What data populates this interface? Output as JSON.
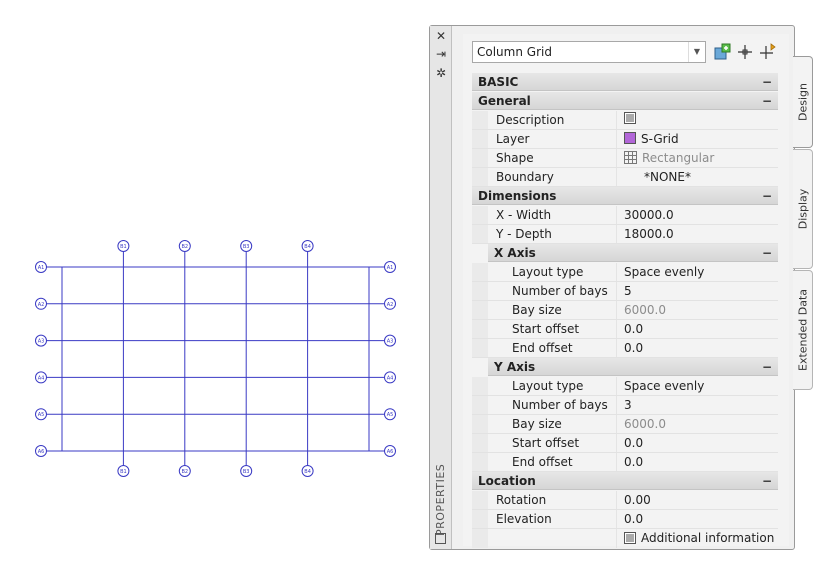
{
  "drawing": {
    "row_labels": [
      "A1",
      "A2",
      "A3",
      "A4",
      "A5",
      "A6"
    ],
    "col_labels": [
      "B1",
      "B2",
      "B3",
      "B4"
    ],
    "line_color": "#3a3ac4"
  },
  "palette": {
    "title": "PROPERTIES",
    "style_value": "Column Grid",
    "tabs": [
      "Design",
      "Display",
      "Extended Data"
    ],
    "sections": {
      "basic": "BASIC",
      "general": "General",
      "dimensions": "Dimensions",
      "x_axis": "X Axis",
      "y_axis": "Y Axis",
      "location": "Location"
    },
    "general": [
      {
        "label": "Description",
        "value": ""
      },
      {
        "label": "Layer",
        "value": "S-Grid",
        "color": "#b266d8"
      },
      {
        "label": "Shape",
        "value": "Rectangular"
      },
      {
        "label": "Boundary",
        "value": "*NONE*"
      }
    ],
    "dimensions": [
      {
        "label": "X - Width",
        "value": "30000.0"
      },
      {
        "label": "Y - Depth",
        "value": "18000.0"
      }
    ],
    "x_axis": [
      {
        "label": "Layout type",
        "value": "Space evenly"
      },
      {
        "label": "Number of bays",
        "value": "5"
      },
      {
        "label": "Bay size",
        "value": "6000.0"
      },
      {
        "label": "Start offset",
        "value": "0.0"
      },
      {
        "label": "End offset",
        "value": "0.0"
      }
    ],
    "y_axis": [
      {
        "label": "Layout type",
        "value": "Space evenly"
      },
      {
        "label": "Number of bays",
        "value": "3"
      },
      {
        "label": "Bay size",
        "value": "6000.0"
      },
      {
        "label": "Start offset",
        "value": "0.0"
      },
      {
        "label": "End offset",
        "value": "0.0"
      }
    ],
    "location": [
      {
        "label": "Rotation",
        "value": "0.00"
      },
      {
        "label": "Elevation",
        "value": "0.0"
      }
    ],
    "additional_info": "Additional information"
  }
}
